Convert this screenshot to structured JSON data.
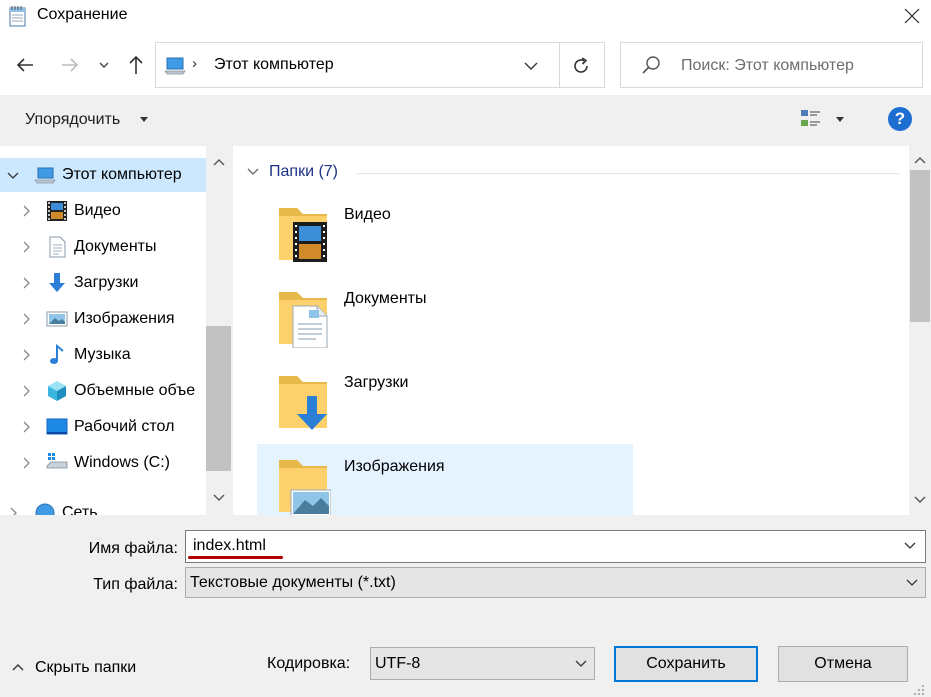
{
  "window": {
    "title": "Сохранение"
  },
  "address": {
    "path": "Этот компьютер",
    "separator": "›"
  },
  "search": {
    "placeholder": "Поиск: Этот компьютер"
  },
  "toolbar": {
    "organize": "Упорядочить",
    "help": "?"
  },
  "nav_tree": [
    {
      "label": "Этот компьютер",
      "icon": "computer-icon",
      "selected": true,
      "expanded": true
    },
    {
      "label": "Видео",
      "icon": "video-icon"
    },
    {
      "label": "Документы",
      "icon": "documents-icon"
    },
    {
      "label": "Загрузки",
      "icon": "downloads-icon"
    },
    {
      "label": "Изображения",
      "icon": "pictures-icon"
    },
    {
      "label": "Музыка",
      "icon": "music-icon"
    },
    {
      "label": "Объемные объе",
      "icon": "3d-objects-icon"
    },
    {
      "label": "Рабочий стол",
      "icon": "desktop-icon"
    },
    {
      "label": "Windows (C:)",
      "icon": "drive-icon"
    },
    {
      "label": "Сеть",
      "icon": "network-icon"
    }
  ],
  "content": {
    "group_title": "Папки (7)",
    "folders": [
      {
        "label": "Видео",
        "icon": "video-folder-icon"
      },
      {
        "label": "Документы",
        "icon": "documents-folder-icon"
      },
      {
        "label": "Загрузки",
        "icon": "downloads-folder-icon"
      },
      {
        "label": "Изображения",
        "icon": "pictures-folder-icon",
        "selected": true
      }
    ]
  },
  "form": {
    "filename_label": "Имя файла:",
    "filename_value": "index.html",
    "filetype_label": "Тип файла:",
    "filetype_value": "Текстовые документы (*.txt)",
    "encoding_label": "Кодировка:",
    "encoding_value": "UTF-8",
    "hide_folders": "Скрыть папки",
    "save": "Сохранить",
    "cancel": "Отмена"
  },
  "colors": {
    "accent": "#0078d7",
    "selection": "#cce8ff",
    "hover": "#e5f3ff",
    "group_title": "#1e3287",
    "underline": "#b00000"
  }
}
